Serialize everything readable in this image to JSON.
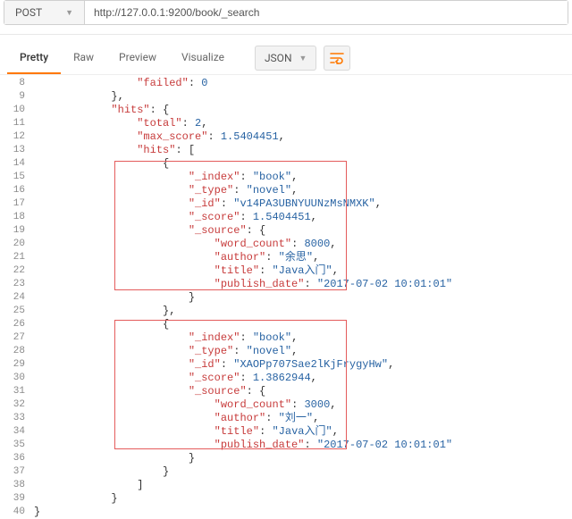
{
  "request": {
    "method": "POST",
    "url": "http://127.0.0.1:9200/book/_search"
  },
  "tabs": {
    "pretty": "Pretty",
    "raw": "Raw",
    "preview": "Preview",
    "visualize": "Visualize"
  },
  "format": {
    "label": "JSON"
  },
  "code": {
    "lines": [
      {
        "n": 8,
        "indent": 4,
        "tokens": [
          [
            "key",
            "\"failed\""
          ],
          [
            "brace",
            ": "
          ],
          [
            "num",
            "0"
          ]
        ]
      },
      {
        "n": 9,
        "indent": 3,
        "tokens": [
          [
            "brace",
            "},"
          ]
        ]
      },
      {
        "n": 10,
        "indent": 3,
        "tokens": [
          [
            "key",
            "\"hits\""
          ],
          [
            "brace",
            ": {"
          ]
        ]
      },
      {
        "n": 11,
        "indent": 4,
        "tokens": [
          [
            "key",
            "\"total\""
          ],
          [
            "brace",
            ": "
          ],
          [
            "num",
            "2"
          ],
          [
            "brace",
            ","
          ]
        ]
      },
      {
        "n": 12,
        "indent": 4,
        "tokens": [
          [
            "key",
            "\"max_score\""
          ],
          [
            "brace",
            ": "
          ],
          [
            "num",
            "1.5404451"
          ],
          [
            "brace",
            ","
          ]
        ]
      },
      {
        "n": 13,
        "indent": 4,
        "tokens": [
          [
            "key",
            "\"hits\""
          ],
          [
            "brace",
            ": ["
          ]
        ]
      },
      {
        "n": 14,
        "indent": 5,
        "tokens": [
          [
            "brace",
            "{"
          ]
        ]
      },
      {
        "n": 15,
        "indent": 6,
        "tokens": [
          [
            "key",
            "\"_index\""
          ],
          [
            "brace",
            ": "
          ],
          [
            "str",
            "\"book\""
          ],
          [
            "brace",
            ","
          ]
        ]
      },
      {
        "n": 16,
        "indent": 6,
        "tokens": [
          [
            "key",
            "\"_type\""
          ],
          [
            "brace",
            ": "
          ],
          [
            "str",
            "\"novel\""
          ],
          [
            "brace",
            ","
          ]
        ]
      },
      {
        "n": 17,
        "indent": 6,
        "tokens": [
          [
            "key",
            "\"_id\""
          ],
          [
            "brace",
            ": "
          ],
          [
            "str",
            "\"v14PA3UBNYUUNzMsNMXK\""
          ],
          [
            "brace",
            ","
          ]
        ]
      },
      {
        "n": 18,
        "indent": 6,
        "tokens": [
          [
            "key",
            "\"_score\""
          ],
          [
            "brace",
            ": "
          ],
          [
            "num",
            "1.5404451"
          ],
          [
            "brace",
            ","
          ]
        ]
      },
      {
        "n": 19,
        "indent": 6,
        "tokens": [
          [
            "key",
            "\"_source\""
          ],
          [
            "brace",
            ": {"
          ]
        ]
      },
      {
        "n": 20,
        "indent": 7,
        "tokens": [
          [
            "key",
            "\"word_count\""
          ],
          [
            "brace",
            ": "
          ],
          [
            "num",
            "8000"
          ],
          [
            "brace",
            ","
          ]
        ]
      },
      {
        "n": 21,
        "indent": 7,
        "tokens": [
          [
            "key",
            "\"author\""
          ],
          [
            "brace",
            ": "
          ],
          [
            "str",
            "\"余思\""
          ],
          [
            "brace",
            ","
          ]
        ]
      },
      {
        "n": 22,
        "indent": 7,
        "tokens": [
          [
            "key",
            "\"title\""
          ],
          [
            "brace",
            ": "
          ],
          [
            "str",
            "\"Java入门\""
          ],
          [
            "brace",
            ","
          ]
        ]
      },
      {
        "n": 23,
        "indent": 7,
        "tokens": [
          [
            "key",
            "\"publish_date\""
          ],
          [
            "brace",
            ": "
          ],
          [
            "str",
            "\"2017-07-02 10:01:01\""
          ]
        ]
      },
      {
        "n": 24,
        "indent": 6,
        "tokens": [
          [
            "brace",
            "}"
          ]
        ]
      },
      {
        "n": 25,
        "indent": 5,
        "tokens": [
          [
            "brace",
            "},"
          ]
        ]
      },
      {
        "n": 26,
        "indent": 5,
        "tokens": [
          [
            "brace",
            "{"
          ]
        ]
      },
      {
        "n": 27,
        "indent": 6,
        "tokens": [
          [
            "key",
            "\"_index\""
          ],
          [
            "brace",
            ": "
          ],
          [
            "str",
            "\"book\""
          ],
          [
            "brace",
            ","
          ]
        ]
      },
      {
        "n": 28,
        "indent": 6,
        "tokens": [
          [
            "key",
            "\"_type\""
          ],
          [
            "brace",
            ": "
          ],
          [
            "str",
            "\"novel\""
          ],
          [
            "brace",
            ","
          ]
        ]
      },
      {
        "n": 29,
        "indent": 6,
        "tokens": [
          [
            "key",
            "\"_id\""
          ],
          [
            "brace",
            ": "
          ],
          [
            "str",
            "\"XAOPp707Sae2lKjFrygyHw\""
          ],
          [
            "brace",
            ","
          ]
        ]
      },
      {
        "n": 30,
        "indent": 6,
        "tokens": [
          [
            "key",
            "\"_score\""
          ],
          [
            "brace",
            ": "
          ],
          [
            "num",
            "1.3862944"
          ],
          [
            "brace",
            ","
          ]
        ]
      },
      {
        "n": 31,
        "indent": 6,
        "tokens": [
          [
            "key",
            "\"_source\""
          ],
          [
            "brace",
            ": {"
          ]
        ]
      },
      {
        "n": 32,
        "indent": 7,
        "tokens": [
          [
            "key",
            "\"word_count\""
          ],
          [
            "brace",
            ": "
          ],
          [
            "num",
            "3000"
          ],
          [
            "brace",
            ","
          ]
        ]
      },
      {
        "n": 33,
        "indent": 7,
        "tokens": [
          [
            "key",
            "\"author\""
          ],
          [
            "brace",
            ": "
          ],
          [
            "str",
            "\"刘一\""
          ],
          [
            "brace",
            ","
          ]
        ]
      },
      {
        "n": 34,
        "indent": 7,
        "tokens": [
          [
            "key",
            "\"title\""
          ],
          [
            "brace",
            ": "
          ],
          [
            "str",
            "\"Java入门\""
          ],
          [
            "brace",
            ","
          ]
        ]
      },
      {
        "n": 35,
        "indent": 7,
        "tokens": [
          [
            "key",
            "\"publish_date\""
          ],
          [
            "brace",
            ": "
          ],
          [
            "str",
            "\"2017-07-02 10:01:01\""
          ]
        ]
      },
      {
        "n": 36,
        "indent": 6,
        "tokens": [
          [
            "brace",
            "}"
          ]
        ]
      },
      {
        "n": 37,
        "indent": 5,
        "tokens": [
          [
            "brace",
            "}"
          ]
        ]
      },
      {
        "n": 38,
        "indent": 4,
        "tokens": [
          [
            "brace",
            "]"
          ]
        ]
      },
      {
        "n": 39,
        "indent": 3,
        "tokens": [
          [
            "brace",
            "}"
          ]
        ]
      },
      {
        "n": 40,
        "indent": 0,
        "tokens": [
          [
            "brace",
            "}"
          ]
        ]
      }
    ]
  }
}
